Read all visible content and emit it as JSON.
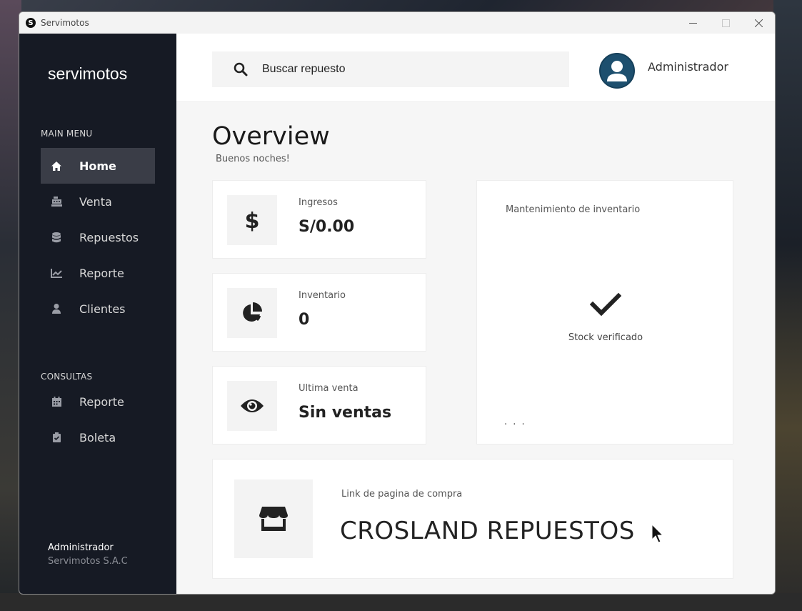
{
  "window": {
    "title": "Servimotos",
    "app_icon": "S"
  },
  "sidebar": {
    "brand": "servimotos",
    "main_menu_label": "MAIN MENU",
    "main_items": [
      {
        "label": "Home",
        "icon": "home-icon",
        "active": true
      },
      {
        "label": "Venta",
        "icon": "cash-register-icon",
        "active": false
      },
      {
        "label": "Repuestos",
        "icon": "database-icon",
        "active": false
      },
      {
        "label": "Reporte",
        "icon": "line-chart-icon",
        "active": false
      },
      {
        "label": "Clientes",
        "icon": "user-icon",
        "active": false
      }
    ],
    "consultas_label": "CONSULTAS",
    "consultas_items": [
      {
        "label": "Reporte",
        "icon": "calendar-icon"
      },
      {
        "label": "Boleta",
        "icon": "clipboard-check-icon"
      }
    ],
    "user": {
      "name": "Administrador",
      "company": "Servimotos S.A.C"
    }
  },
  "topbar": {
    "search_placeholder": "Buscar repuesto",
    "user_label": "Administrador"
  },
  "main": {
    "title": "Overview",
    "greeting": "Buenos noches!",
    "stats": [
      {
        "label": "Ingresos",
        "value": "S/0.00",
        "icon": "dollar-icon"
      },
      {
        "label": "Inventario",
        "value": "0",
        "icon": "pie-chart-icon"
      },
      {
        "label": "Ultima venta",
        "value": "Sin ventas",
        "icon": "eye-icon"
      }
    ],
    "maintenance": {
      "title": "Mantenimiento de inventario",
      "status": "Stock verificado",
      "footer": ". . ."
    },
    "link": {
      "label": "Link de pagina de compra",
      "value": "CROSLAND REPUESTOS",
      "icon": "store-icon"
    }
  },
  "colors": {
    "sidebar_bg": "#161a24",
    "active_item_bg": "#3a3d47",
    "avatar_bg": "#1d4f6e"
  }
}
